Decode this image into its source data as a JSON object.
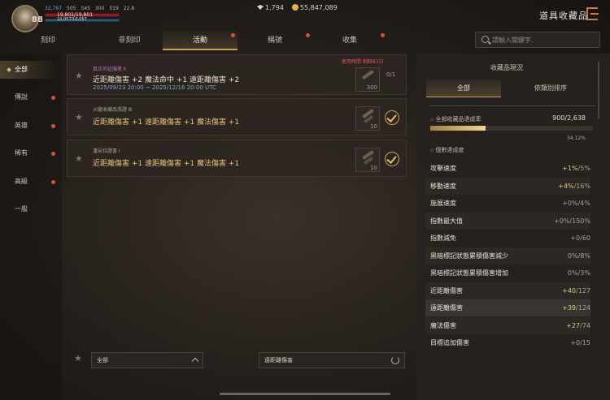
{
  "player": {
    "level": "88",
    "stats": [
      "32,767",
      "505",
      "545",
      "300",
      "519",
      "22.8"
    ],
    "hp": "19,801/19,801",
    "mp": "10,057/10,057"
  },
  "currency": {
    "diamonds": "1,794",
    "gold": "55,847,089"
  },
  "page_title": "道具收藏品",
  "tabs": [
    {
      "label": "刻印",
      "dot": false
    },
    {
      "label": "非刻印",
      "dot": false
    },
    {
      "label": "活動",
      "dot": true,
      "active": true
    },
    {
      "label": "稱號",
      "dot": true
    },
    {
      "label": "收集",
      "dot": true
    }
  ],
  "search": {
    "placeholder": "請輸入關鍵字."
  },
  "sidebar": [
    {
      "label": "全部",
      "active": true,
      "dot": false
    },
    {
      "label": "傳說",
      "dot": true
    },
    {
      "label": "英雄",
      "dot": true
    },
    {
      "label": "稀有",
      "dot": true
    },
    {
      "label": "高級",
      "dot": true
    },
    {
      "label": "一般",
      "dot": false
    }
  ],
  "cards": [
    {
      "subtitle": "真正的征服者 Ⅱ",
      "effects": "近距離傷害 +2 魔法命中 +1 遠距離傷害 +2",
      "date": "2025/09/23 20:00 ~ 2025/12/16 20:00 UTC",
      "limit": "使用時間 剩餘83日",
      "count": "300",
      "progress": "0/1"
    },
    {
      "subtitle": "火龍收藏品憑證 Ⅲ",
      "effects": "近距離傷害 +1 遠距離傷害 +1 魔法傷害 +1",
      "count": "10"
    },
    {
      "subtitle": "潘朵拉證書 Ⅰ",
      "effects": "近距離傷害 +1 遠距離傷害 +1 魔法傷害 +1",
      "count": "10"
    }
  ],
  "filters": {
    "category": "全部",
    "stat": "遠距離傷害"
  },
  "right_panel": {
    "title": "收藏品現況",
    "tabs": [
      "全部",
      "依類別排序"
    ],
    "rate_label": "全部收藏品達成率",
    "rate_value": "900/2,638",
    "rate_pct": "34.12%",
    "rate_fraction": 0.3412,
    "sub_label": "個數達成度",
    "rows": [
      {
        "name": "攻擊速度",
        "cur": "+1%",
        "max": "/5%"
      },
      {
        "name": "移動速度",
        "cur": "+4%",
        "max": "/16%"
      },
      {
        "name": "施展速度",
        "cur": "+0%",
        "max": "/4%"
      },
      {
        "name": "指數最大值",
        "cur": "+0%",
        "max": "/150%"
      },
      {
        "name": "指數減免",
        "cur": "+0",
        "max": "/60"
      },
      {
        "name": "黑暗標記狀態累積傷害減少",
        "cur": "0%",
        "max": "/8%"
      },
      {
        "name": "黑暗標記狀態累積傷害增加",
        "cur": "0%",
        "max": "/3%"
      },
      {
        "name": "近距離傷害",
        "cur": "+40",
        "max": "/127"
      },
      {
        "name": "遠距離傷害",
        "cur": "+39",
        "max": "/124"
      },
      {
        "name": "魔法傷害",
        "cur": "+27",
        "max": "/74"
      },
      {
        "name": "目標追加傷害",
        "cur": "+0",
        "max": "/15"
      }
    ]
  }
}
